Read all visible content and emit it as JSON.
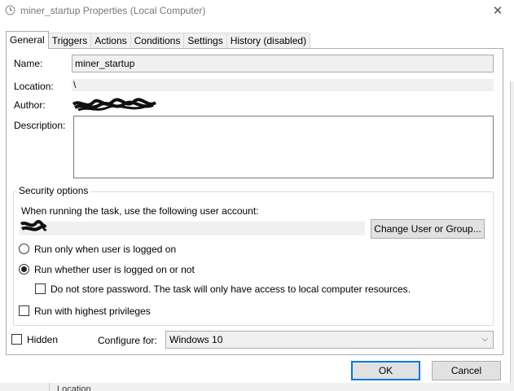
{
  "window": {
    "title": "miner_startup Properties (Local Computer)",
    "close_glyph": "✕"
  },
  "tabs": [
    "General",
    "Triggers",
    "Actions",
    "Conditions",
    "Settings",
    "History (disabled)"
  ],
  "general": {
    "name_label": "Name:",
    "name_value": "miner_startup",
    "location_label": "Location:",
    "location_value": "\\",
    "author_label": "Author:",
    "description_label": "Description:"
  },
  "security": {
    "group_title": "Security options",
    "account_prompt": "When running the task, use the following user account:",
    "change_user_button": "Change User or Group...",
    "radio_logged_on": "Run only when user is logged on",
    "radio_whether": "Run whether user is logged on or not",
    "selected_radio": "whether",
    "do_not_store": "Do not store password.  The task will only have access to local computer resources.",
    "highest_privileges": "Run with highest privileges"
  },
  "footer": {
    "hidden_label": "Hidden",
    "configure_label": "Configure for:",
    "configure_value": "Windows 10",
    "ok_button": "OK",
    "cancel_button": "Cancel"
  },
  "background_peek": {
    "text": "Location"
  },
  "colors": {
    "accent": "#0078d7",
    "field_bg": "#f0f0f0"
  }
}
